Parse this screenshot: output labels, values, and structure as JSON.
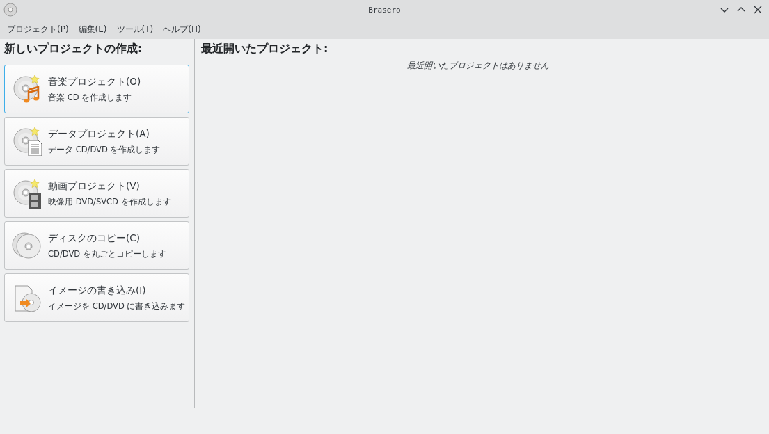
{
  "window": {
    "title": "Brasero"
  },
  "menu": [
    {
      "label": "プロジェクト(P)"
    },
    {
      "label": "編集(E)"
    },
    {
      "label": "ツール(T)"
    },
    {
      "label": "ヘルプ(H)"
    }
  ],
  "new_project": {
    "heading": "新しいプロジェクトの作成:",
    "items": [
      {
        "kind": "music",
        "title": "音楽プロジェクト(O)",
        "subtitle": "音楽 CD を作成します",
        "focused": true
      },
      {
        "kind": "data",
        "title": "データプロジェクト(A)",
        "subtitle": "データ CD/DVD を作成します",
        "focused": false
      },
      {
        "kind": "video",
        "title": "動画プロジェクト(V)",
        "subtitle": "映像用 DVD/SVCD を作成します",
        "focused": false
      },
      {
        "kind": "copy",
        "title": "ディスクのコピー(C)",
        "subtitle": "CD/DVD を丸ごとコピーします",
        "focused": false
      },
      {
        "kind": "image",
        "title": "イメージの書き込み(I)",
        "subtitle": "イメージを CD/DVD に書き込みます",
        "focused": false
      }
    ]
  },
  "recent": {
    "heading": "最近開いたプロジェクト:",
    "empty_message": "最近開いたプロジェクトはありません"
  }
}
